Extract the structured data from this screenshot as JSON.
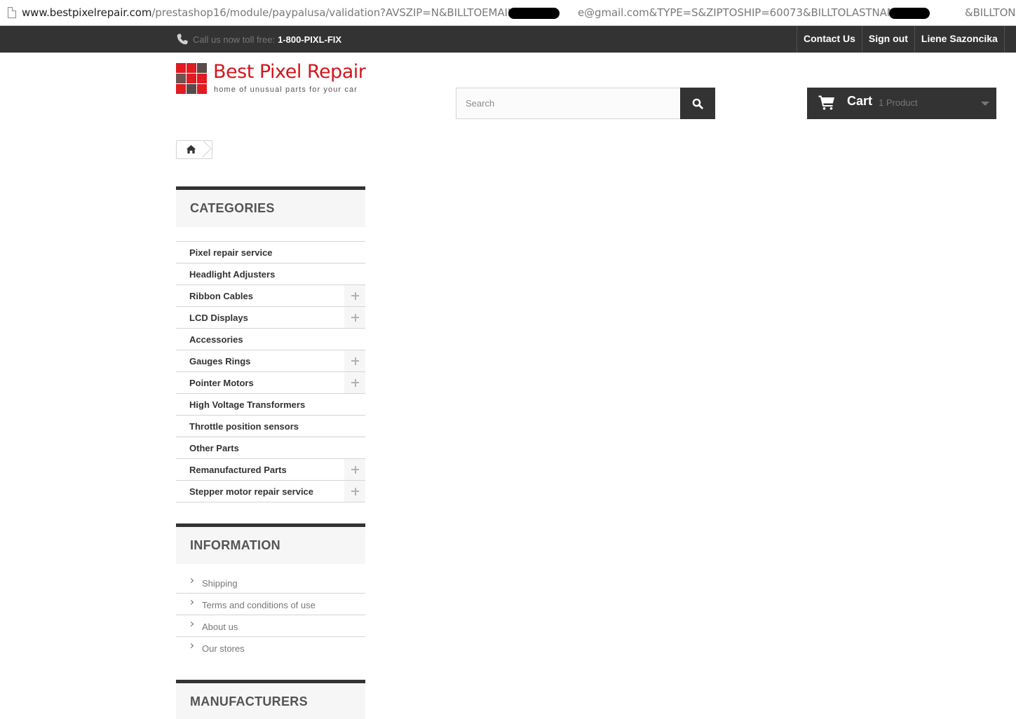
{
  "browser": {
    "url_host": "www.bestpixelrepair.com",
    "url_path": "/prestashop16/module/paypalusa/validation?AVSZIP=N&BILLTOEMAIL=b",
    "url_mid": "e@gmail.com&TYPE=S&ZIPTOSHIP=60073&BILLTOLASTNAME=Sa",
    "url_tail": "&BILLTONAME=L"
  },
  "topnav": {
    "phone_label": "Call us now toll free:",
    "phone_number": "1-800-PIXL-FIX",
    "links": [
      "Contact Us",
      "Sign out",
      "Liene Sazoncika"
    ]
  },
  "logo": {
    "name": "Best Pixel Repair",
    "tagline": "home of unusual parts for your car",
    "colors": [
      "#e01b22",
      "#e01b22",
      "#5a4a4a",
      "#6b5454",
      "#e01b22",
      "#e01b22",
      "#e01b22",
      "#5a4a4a",
      "#e01b22"
    ]
  },
  "search": {
    "placeholder": "Search",
    "value": ""
  },
  "cart": {
    "label": "Cart",
    "quantity": "1 Product"
  },
  "categories": {
    "title": "Categories",
    "items": [
      {
        "label": "Pixel repair service",
        "expandable": false
      },
      {
        "label": "Headlight Adjusters",
        "expandable": false
      },
      {
        "label": "Ribbon Cables",
        "expandable": true
      },
      {
        "label": "LCD Displays",
        "expandable": true
      },
      {
        "label": "Accessories",
        "expandable": false
      },
      {
        "label": "Gauges Rings",
        "expandable": true
      },
      {
        "label": "Pointer Motors",
        "expandable": true
      },
      {
        "label": "High Voltage Transformers",
        "expandable": false
      },
      {
        "label": "Throttle position sensors",
        "expandable": false
      },
      {
        "label": "Other Parts",
        "expandable": false
      },
      {
        "label": "Remanufactured Parts",
        "expandable": true
      },
      {
        "label": "Stepper motor repair service",
        "expandable": true
      }
    ]
  },
  "information": {
    "title": "Information",
    "items": [
      "Shipping",
      "Terms and conditions of use",
      "About us",
      "Our stores"
    ]
  },
  "manufacturers": {
    "title": "Manufacturers"
  },
  "colors": {
    "dark": "#333333",
    "brand_red": "#d1171d",
    "panel": "#f6f6f6",
    "border": "#d6d4d4"
  }
}
